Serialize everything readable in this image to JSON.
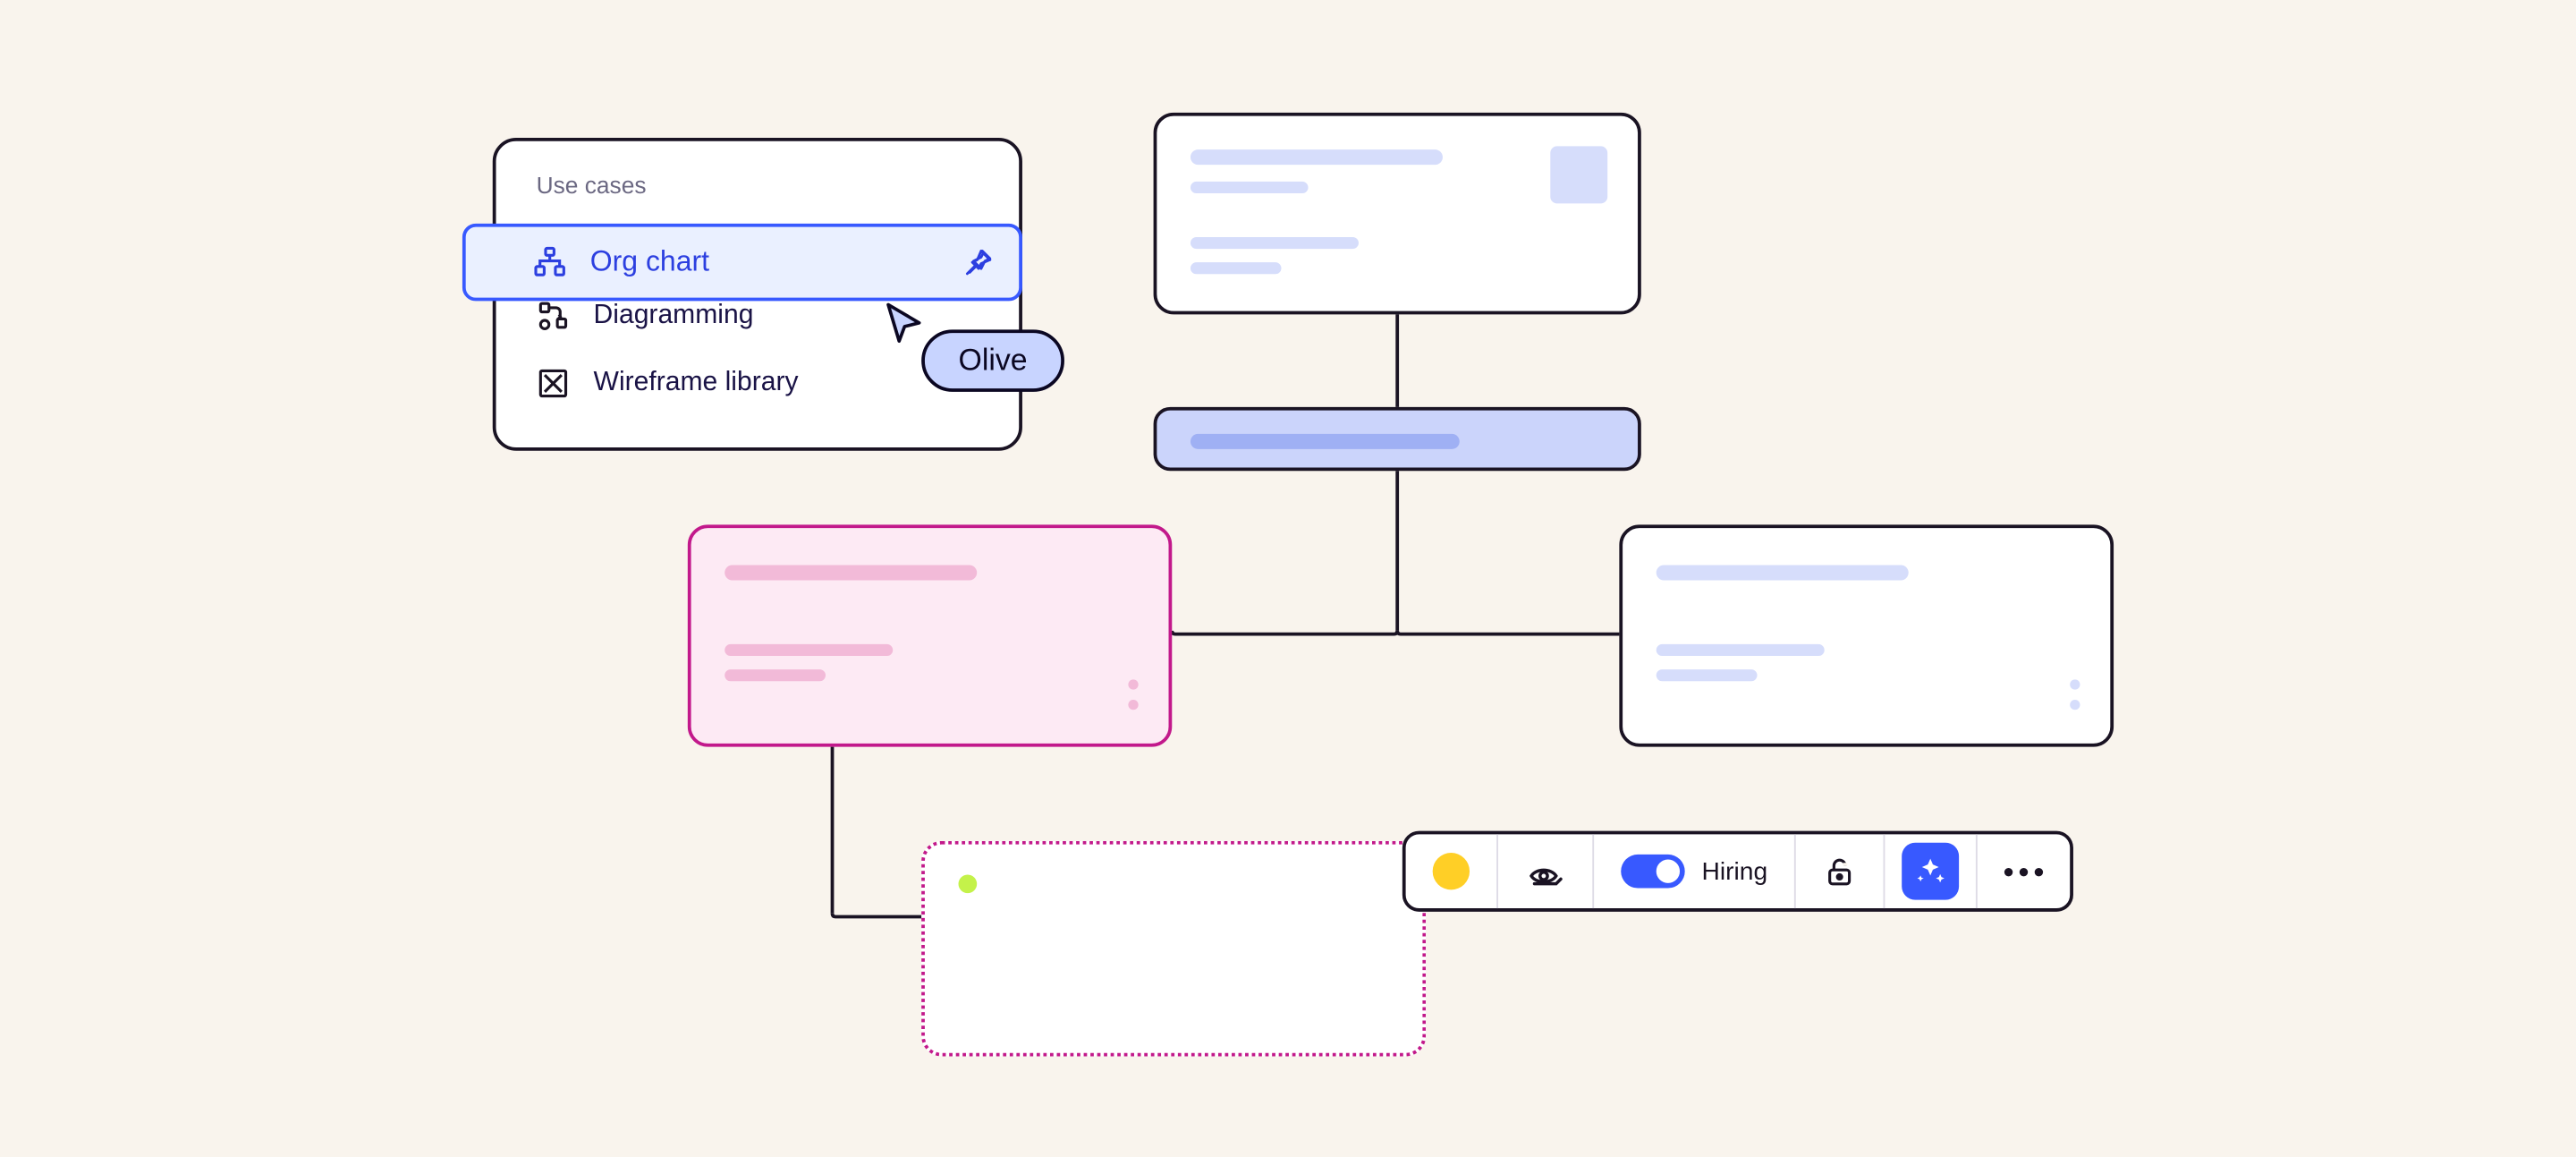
{
  "panel": {
    "title": "Use cases",
    "items": [
      {
        "label": "Org chart",
        "icon": "org-chart-icon",
        "selected": true
      },
      {
        "label": "Diagramming",
        "icon": "diagram-icon",
        "selected": false
      },
      {
        "label": "Wireframe library",
        "icon": "wireframe-icon",
        "selected": false
      }
    ]
  },
  "cursor": {
    "user_name": "Olive"
  },
  "toolbar": {
    "color_swatch": "#ffcf26",
    "toggle_label": "Hiring",
    "toggle_on": true
  },
  "colors": {
    "accent_blue": "#3859ff",
    "accent_magenta": "#c2198b",
    "skeleton_lavender": "#d6ddfb",
    "skeleton_pink": "#f2bad8",
    "panel_selected_bg": "#eaf0ff",
    "cursor_pill_bg": "#c8d4ff",
    "yellow": "#ffcf26",
    "green_dot": "#c4f24a"
  }
}
